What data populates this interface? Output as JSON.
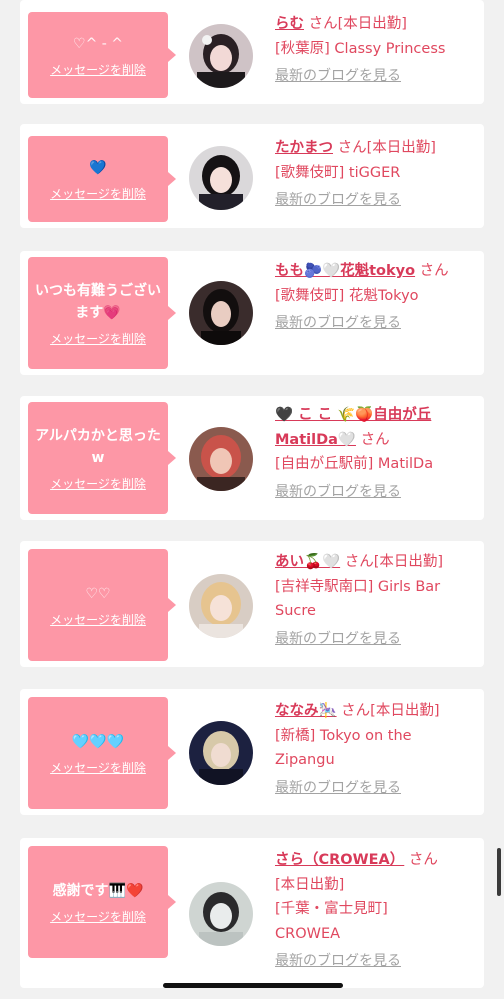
{
  "delete_label": "メッセージを削除",
  "blog_label": "最新のブログを見る",
  "san_label": "さん",
  "cards": [
    {
      "message": "♡^ - ^",
      "name": "らむ",
      "status": "[本日出勤]",
      "shop": "[秋葉原] Classy Princess"
    },
    {
      "message": "💙",
      "name": "たかまつ",
      "status": "[本日出勤]",
      "shop": "[歌舞伎町] tiGGER"
    },
    {
      "message": "いつも有難うございます💗",
      "name": "もも🫐🤍花魁tokyo",
      "status": "",
      "shop": "[歌舞伎町] 花魁Tokyo"
    },
    {
      "message": "アルパカかと思ったw",
      "name": "🖤 こ こ 🌾🍑自由が丘MatilDa🤍",
      "status": "",
      "shop": "[自由が丘駅前] MatilDa"
    },
    {
      "message": "♡♡",
      "name": "あい🍒🤍",
      "status": "[本日出勤]",
      "shop": "[吉祥寺駅南口] Girls Bar Sucre"
    },
    {
      "message": "🩵🩵🩵",
      "name": "ななみ🎠",
      "status": "[本日出勤]",
      "shop": "[新橋] Tokyo on the Zipangu"
    },
    {
      "message": "感謝です🎹❤️",
      "name": "さら（CROWEA）",
      "status": "[本日出勤]",
      "shop": "[千葉・富士見町] CROWEA"
    }
  ]
}
